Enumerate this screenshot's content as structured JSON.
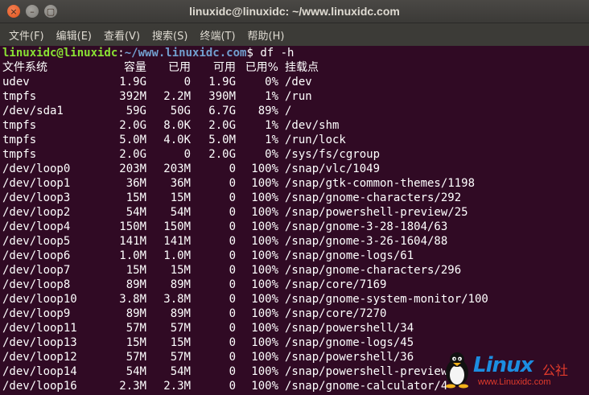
{
  "window": {
    "title": "linuxidc@linuxidc: ~/www.linuxidc.com",
    "controls": {
      "close_icon": "close-icon",
      "minimize_icon": "minimize-icon",
      "maximize_icon": "maximize-icon"
    }
  },
  "menu": [
    "文件(F)",
    "编辑(E)",
    "查看(V)",
    "搜索(S)",
    "终端(T)",
    "帮助(H)"
  ],
  "terminal": {
    "prompt_user": "linuxidc@linuxidc",
    "prompt_sep": ":",
    "prompt_path": "~/www.linuxidc.com",
    "prompt_symbol": "$ ",
    "command": "df -h",
    "header": [
      "文件系统",
      "容量",
      "已用",
      "可用",
      "已用%",
      "挂载点"
    ],
    "rows": [
      [
        "udev",
        "1.9G",
        "0",
        "1.9G",
        "0%",
        "/dev"
      ],
      [
        "tmpfs",
        "392M",
        "2.2M",
        "390M",
        "1%",
        "/run"
      ],
      [
        "/dev/sda1",
        "59G",
        "50G",
        "6.7G",
        "89%",
        "/"
      ],
      [
        "tmpfs",
        "2.0G",
        "8.0K",
        "2.0G",
        "1%",
        "/dev/shm"
      ],
      [
        "tmpfs",
        "5.0M",
        "4.0K",
        "5.0M",
        "1%",
        "/run/lock"
      ],
      [
        "tmpfs",
        "2.0G",
        "0",
        "2.0G",
        "0%",
        "/sys/fs/cgroup"
      ],
      [
        "/dev/loop0",
        "203M",
        "203M",
        "0",
        "100%",
        "/snap/vlc/1049"
      ],
      [
        "/dev/loop1",
        "36M",
        "36M",
        "0",
        "100%",
        "/snap/gtk-common-themes/1198"
      ],
      [
        "/dev/loop3",
        "15M",
        "15M",
        "0",
        "100%",
        "/snap/gnome-characters/292"
      ],
      [
        "/dev/loop2",
        "54M",
        "54M",
        "0",
        "100%",
        "/snap/powershell-preview/25"
      ],
      [
        "/dev/loop4",
        "150M",
        "150M",
        "0",
        "100%",
        "/snap/gnome-3-28-1804/63"
      ],
      [
        "/dev/loop5",
        "141M",
        "141M",
        "0",
        "100%",
        "/snap/gnome-3-26-1604/88"
      ],
      [
        "/dev/loop6",
        "1.0M",
        "1.0M",
        "0",
        "100%",
        "/snap/gnome-logs/61"
      ],
      [
        "/dev/loop7",
        "15M",
        "15M",
        "0",
        "100%",
        "/snap/gnome-characters/296"
      ],
      [
        "/dev/loop8",
        "89M",
        "89M",
        "0",
        "100%",
        "/snap/core/7169"
      ],
      [
        "/dev/loop10",
        "3.8M",
        "3.8M",
        "0",
        "100%",
        "/snap/gnome-system-monitor/100"
      ],
      [
        "/dev/loop9",
        "89M",
        "89M",
        "0",
        "100%",
        "/snap/core/7270"
      ],
      [
        "/dev/loop11",
        "57M",
        "57M",
        "0",
        "100%",
        "/snap/powershell/34"
      ],
      [
        "/dev/loop13",
        "15M",
        "15M",
        "0",
        "100%",
        "/snap/gnome-logs/45"
      ],
      [
        "/dev/loop12",
        "57M",
        "57M",
        "0",
        "100%",
        "/snap/powershell/36"
      ],
      [
        "/dev/loop14",
        "54M",
        "54M",
        "0",
        "100%",
        "/snap/powershell-preview/23"
      ],
      [
        "/dev/loop16",
        "2.3M",
        "2.3M",
        "0",
        "100%",
        "/snap/gnome-calculator/4"
      ]
    ]
  },
  "watermark": {
    "icon": "tux-penguin-icon",
    "brand": "Linux",
    "brand_cn": "公社",
    "url": "www.Linuxidc.com"
  },
  "colors": {
    "terminal_bg": "#300a24",
    "prompt_user": "#8ae234",
    "prompt_path": "#729fcf",
    "text": "#ffffff",
    "close_button": "#e1541b",
    "watermark_blue": "#1c8de0",
    "watermark_red": "#e23b2c"
  }
}
